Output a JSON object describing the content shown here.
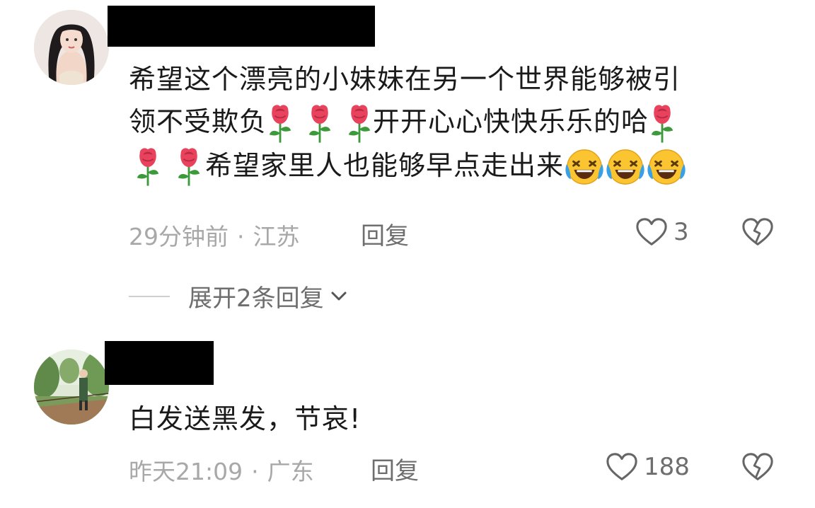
{
  "comments": [
    {
      "avatar": "portrait-avatar",
      "lines": [
        {
          "text": "希望这个漂亮的小妹妹在另一个世界能够被引"
        },
        {
          "pre": "领不受欺负",
          "mid": "开开心心快快乐乐的哈"
        },
        {
          "post": "希望家里人也能够早点走出来"
        }
      ],
      "emojis": [
        "rose",
        "rose",
        "rose",
        "rose",
        "rose",
        "rose",
        "rolling-laughing",
        "rolling-laughing",
        "rolling-laughing"
      ],
      "time": "29分钟前",
      "location": "江苏",
      "dot": "·",
      "reply_label": "回复",
      "likes": "3",
      "expand_label": "展开2条回复"
    },
    {
      "avatar": "landscape-avatar",
      "text": "白发送黑发，节哀!",
      "time": "昨天21:09",
      "location": "广东",
      "dot": "·",
      "reply_label": "回复",
      "likes": "188"
    }
  ],
  "icons": {
    "like": "heart-outline-icon",
    "dislike": "broken-heart-icon",
    "expand": "chevron-down-icon"
  },
  "colors": {
    "text": "#1a1a1a",
    "meta": "#a8a8a8",
    "action": "#6e6e6e",
    "rose": "#e8425c",
    "stem": "#3d9a3a",
    "emoji_face": "#fbc531",
    "tears": "#3aa0e6"
  }
}
